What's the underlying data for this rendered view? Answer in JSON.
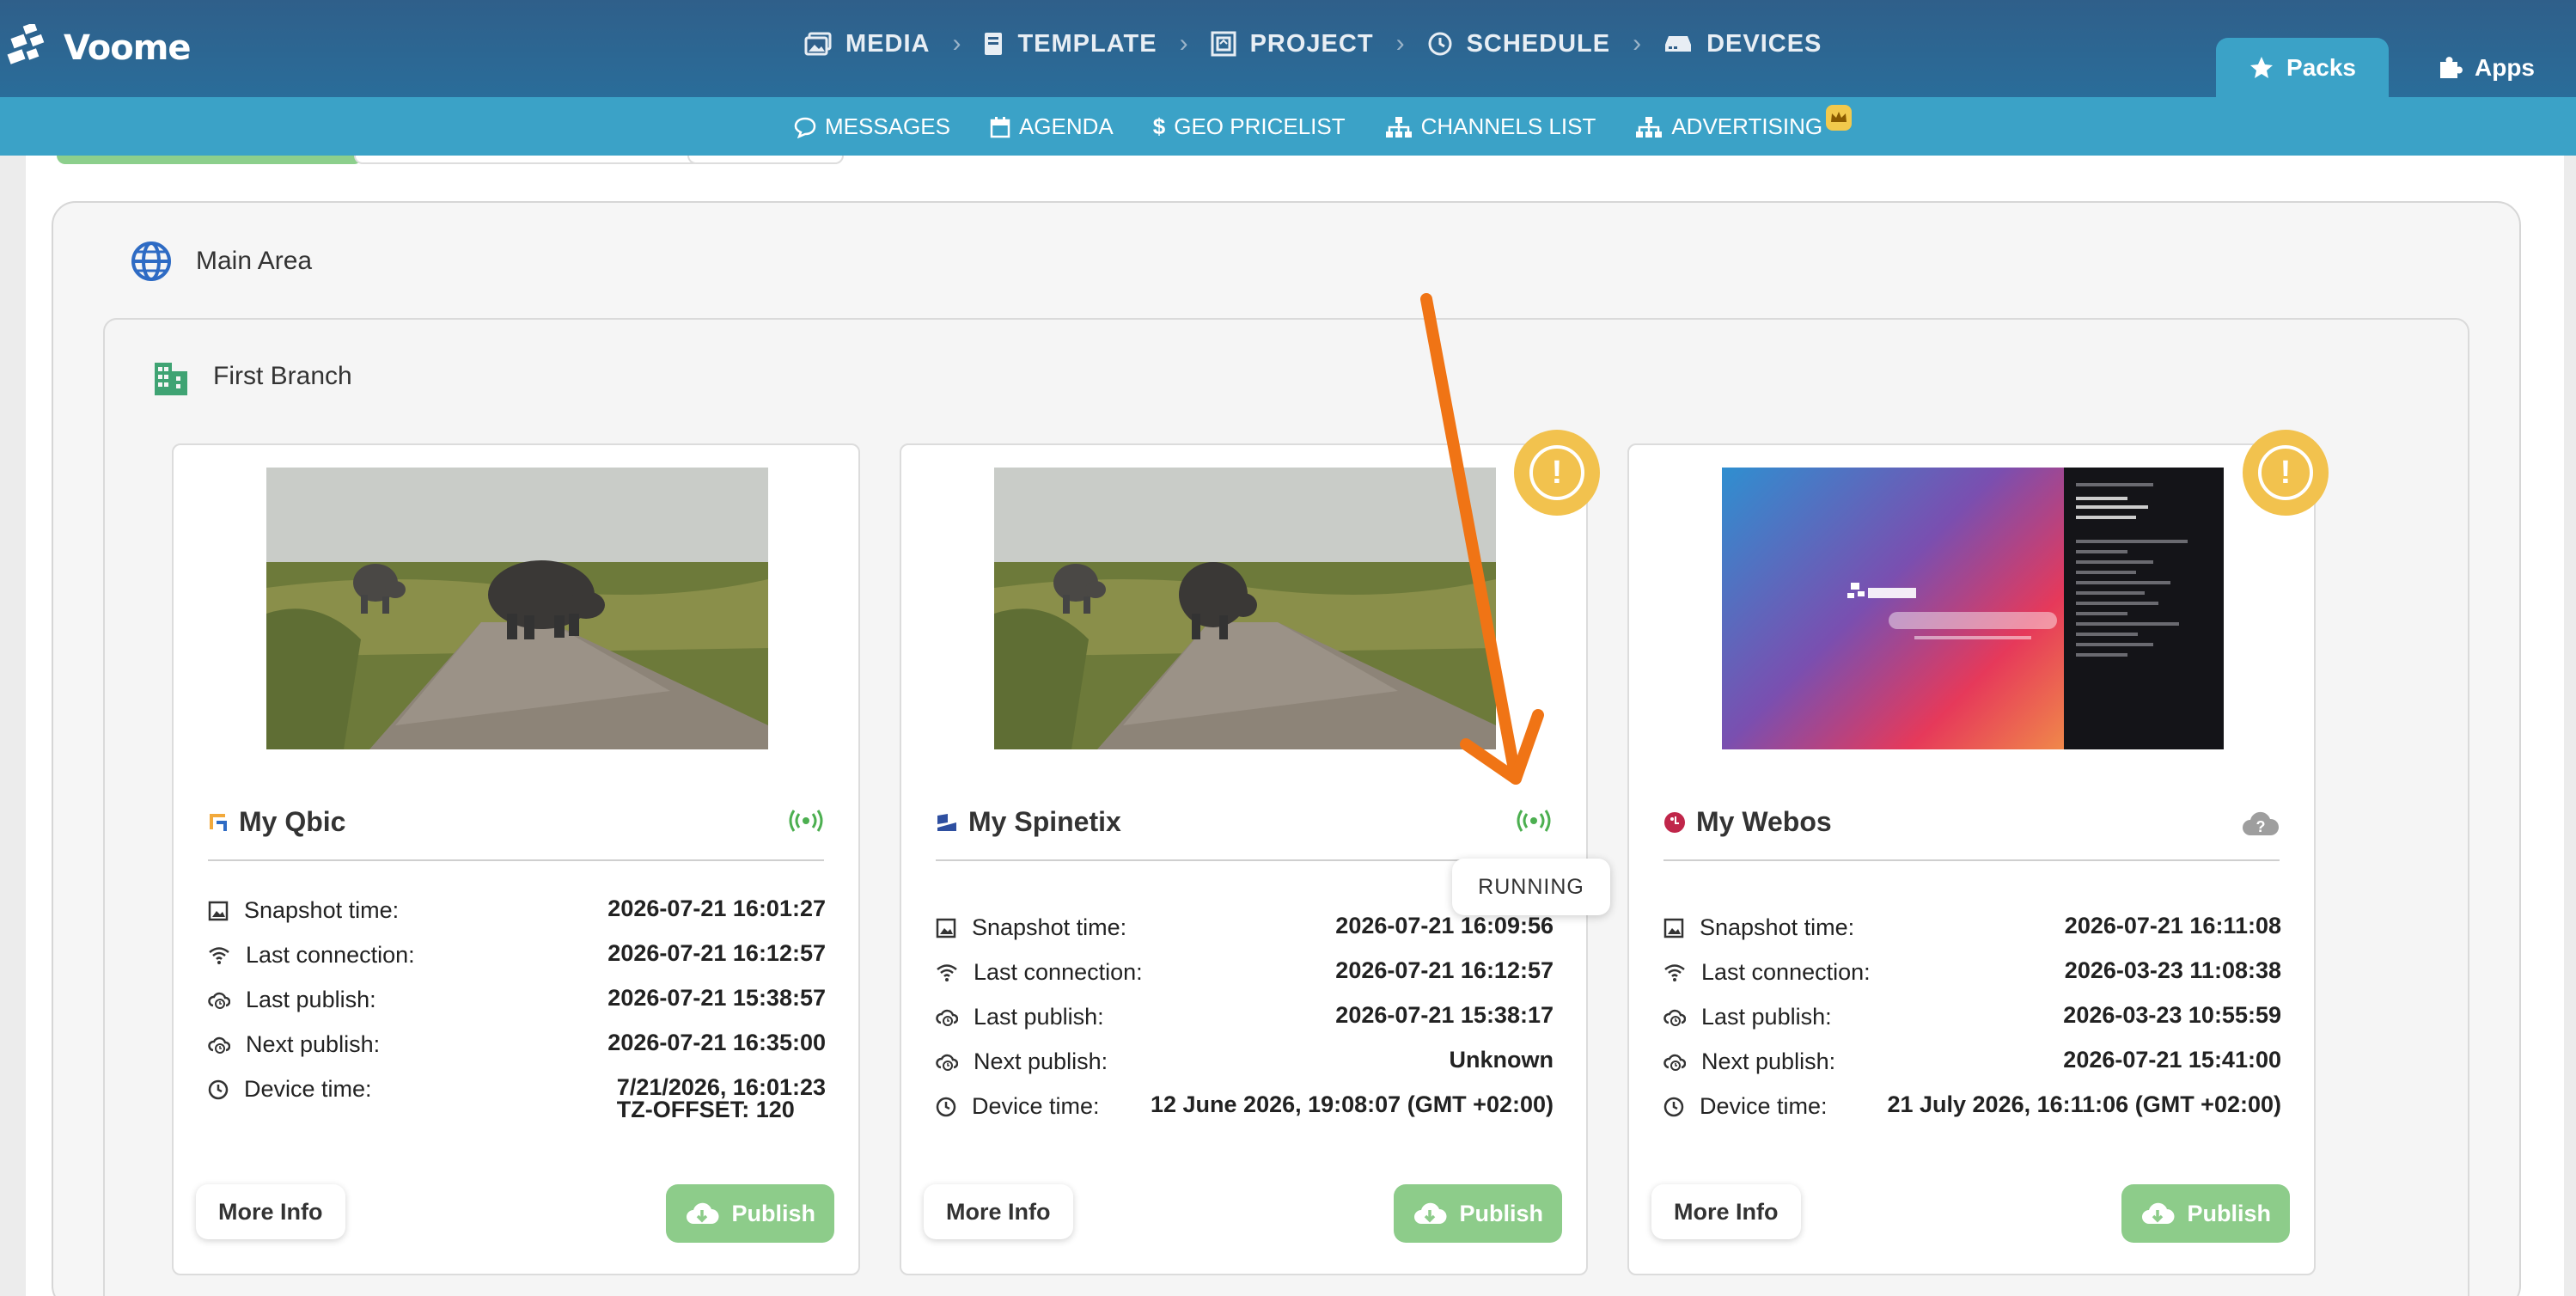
{
  "app": {
    "logo_text": "Voome"
  },
  "main_nav": [
    {
      "label": "MEDIA",
      "icon": "images-icon"
    },
    {
      "label": "TEMPLATE",
      "icon": "book-icon"
    },
    {
      "label": "PROJECT",
      "icon": "project-icon"
    },
    {
      "label": "SCHEDULE",
      "icon": "clock-icon"
    },
    {
      "label": "DEVICES",
      "icon": "device-icon"
    }
  ],
  "top_tabs": [
    {
      "label": "Packs",
      "icon": "star-icon",
      "active": true
    },
    {
      "label": "Apps",
      "icon": "puzzle-icon",
      "active": false
    }
  ],
  "sub_nav": [
    {
      "label": "MESSAGES",
      "icon": "chat-icon"
    },
    {
      "label": "AGENDA",
      "icon": "calendar-icon"
    },
    {
      "label": "GEO PRICELIST",
      "icon": "dollar-icon"
    },
    {
      "label": "CHANNELS LIST",
      "icon": "sitemap-icon"
    },
    {
      "label": "ADVERTISING",
      "icon": "sitemap-icon",
      "badge_icon": "crown-icon"
    }
  ],
  "area": {
    "title": "Main Area"
  },
  "branch": {
    "title": "First Branch"
  },
  "labels": {
    "snapshot_time": "Snapshot time:",
    "last_connection": "Last connection:",
    "last_publish": "Last publish:",
    "next_publish": "Next publish:",
    "device_time": "Device time:",
    "more_info": "More Info",
    "publish": "Publish"
  },
  "tooltip": {
    "text": "RUNNING"
  },
  "devices": [
    {
      "name": "My Qbic",
      "status": "online",
      "snapshot_time": "2026-07-21 16:01:27",
      "last_connection": "2026-07-21 16:12:57",
      "last_publish": "2026-07-21 15:38:57",
      "next_publish": "2026-07-21 16:35:00",
      "device_time": "7/21/2026, 16:01:23",
      "device_time_extra": "TZ-OFFSET: 120",
      "warning": false
    },
    {
      "name": "My Spinetix",
      "status": "online",
      "snapshot_time": "2026-07-21 16:09:56",
      "last_connection": "2026-07-21 16:12:57",
      "last_publish": "2026-07-21 15:38:17",
      "next_publish": "Unknown",
      "device_time": "12 June 2026, 19:08:07 (GMT +02:00)",
      "warning": true
    },
    {
      "name": "My Webos",
      "status": "unknown",
      "snapshot_time": "2026-07-21 16:11:08",
      "last_connection": "2026-03-23 11:08:38",
      "last_publish": "2026-03-23 10:55:59",
      "next_publish": "2026-07-21 15:41:00",
      "device_time": "21 July 2026, 16:11:06 (GMT +02:00)",
      "warning": true
    }
  ],
  "colors": {
    "header": "#2f5f8a",
    "subbar": "#3ba2c7",
    "online": "#4caf50",
    "warning": "#f2c24e",
    "publish": "#8dcc8a",
    "annotation_arrow": "#f07415"
  }
}
